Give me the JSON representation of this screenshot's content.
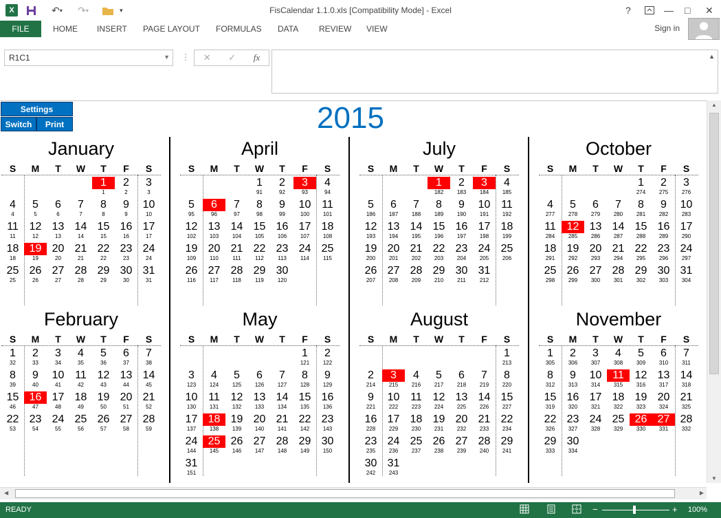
{
  "window": {
    "title": "FisCalendar 1.1.0.xls  [Compatibility Mode] - Excel",
    "help": "?",
    "minimize": "—",
    "maximize": "□",
    "close": "✕"
  },
  "ribbon": {
    "file": "FILE",
    "tabs": [
      "HOME",
      "INSERT",
      "PAGE LAYOUT",
      "FORMULAS",
      "DATA",
      "REVIEW",
      "VIEW"
    ],
    "sign_in": "Sign in"
  },
  "formula": {
    "name_box": "R1C1",
    "cancel": "✕",
    "enter": "✓",
    "fx": "fx",
    "content": ""
  },
  "sheet": {
    "year": "2015",
    "buttons": {
      "settings": "Settings",
      "switch": "Switch",
      "print": "Print"
    },
    "weekdays": [
      "S",
      "M",
      "T",
      "W",
      "T",
      "F",
      "S"
    ],
    "months": [
      {
        "name": "January",
        "start": 4,
        "days": 31,
        "jday_start": 1,
        "highlight": [
          1,
          19
        ]
      },
      {
        "name": "April",
        "start": 3,
        "days": 30,
        "jday_start": 91,
        "highlight": [
          3,
          6
        ]
      },
      {
        "name": "July",
        "start": 3,
        "days": 31,
        "jday_start": 182,
        "highlight": [
          1,
          3
        ]
      },
      {
        "name": "October",
        "start": 4,
        "days": 31,
        "jday_start": 274,
        "highlight": [
          12
        ]
      },
      {
        "name": "February",
        "start": 0,
        "days": 28,
        "jday_start": 32,
        "highlight": [
          16
        ]
      },
      {
        "name": "May",
        "start": 5,
        "days": 31,
        "jday_start": 121,
        "highlight": [
          18,
          25
        ]
      },
      {
        "name": "August",
        "start": 6,
        "days": 31,
        "jday_start": 213,
        "highlight": [
          3
        ]
      },
      {
        "name": "November",
        "start": 0,
        "days": 30,
        "jday_start": 305,
        "highlight": [
          11,
          26,
          27
        ]
      }
    ],
    "highlight_color": "#ff0000",
    "accent_color": "#0070c0"
  },
  "status": {
    "ready": "READY",
    "zoom": "100%"
  },
  "colors": {
    "excel_green": "#217346"
  }
}
